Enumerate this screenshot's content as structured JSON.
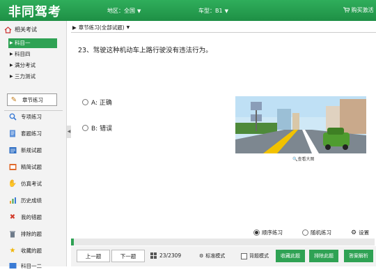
{
  "header": {
    "brand": "非同驾考",
    "region_label": "地区：全国",
    "cartype_label": "车型：B1",
    "cart_label": "购买激活"
  },
  "sidebar": {
    "section_title": "相关考试",
    "exams": [
      {
        "label": "科目一",
        "active": true
      },
      {
        "label": "科目四",
        "active": false
      },
      {
        "label": "满分考试",
        "active": false
      },
      {
        "label": "三力测试",
        "active": false
      }
    ],
    "nav": [
      {
        "label": "章节练习",
        "icon": "pencil-icon",
        "active": true
      },
      {
        "label": "专项练习",
        "icon": "magnifier-icon"
      },
      {
        "label": "套题练习",
        "icon": "document-icon"
      },
      {
        "label": "新规试题",
        "icon": "new-rules-icon"
      },
      {
        "label": "精简试题",
        "icon": "streamlined-icon"
      },
      {
        "label": "仿真考试",
        "icon": "hand-icon"
      },
      {
        "label": "历史成绩",
        "icon": "bar-chart-icon"
      },
      {
        "label": "我的错题",
        "icon": "cross-icon"
      },
      {
        "label": "排除的题",
        "icon": "trash-icon"
      },
      {
        "label": "收藏的题",
        "icon": "star-icon"
      },
      {
        "label": "科目一二",
        "icon": "book-icon"
      }
    ]
  },
  "main": {
    "breadcrumb": "章节练习(全部试题)",
    "question": "23、驾驶这种机动车上路行驶没有违法行为。",
    "options": [
      "A: 正确",
      "B: 错误"
    ],
    "zoom_label": "查看大图",
    "mode_sequential": "顺序练习",
    "mode_random": "随机练习",
    "settings_label": "设置",
    "progress": 0.01
  },
  "bottom": {
    "prev": "上一题",
    "next": "下一题",
    "counter": "23/2309",
    "standard_mode": "标准模式",
    "recite_mode": "背题模式",
    "collect": "收藏此题",
    "exclude": "排除此题",
    "explain": "答案解析"
  },
  "colors": {
    "brand_green": "#2fa254"
  }
}
